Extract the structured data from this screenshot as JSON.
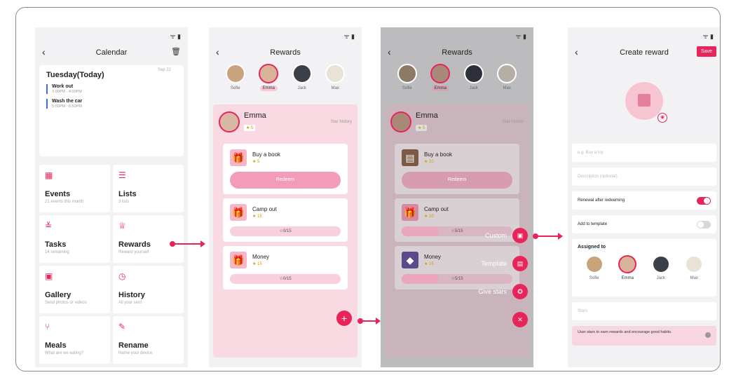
{
  "calendar": {
    "title": "Calendar",
    "day_title": "Tuesday(Today)",
    "day_date": "Sep 22",
    "events": [
      {
        "name": "Work out",
        "time": "3:00PM - 4:00PM"
      },
      {
        "name": "Wash the car",
        "time": "5:00PM - 6:50PM"
      }
    ],
    "tiles": [
      {
        "icon": "calendar-icon",
        "glyph": "▦",
        "name": "Events",
        "sub": "21 events this month"
      },
      {
        "icon": "list-icon",
        "glyph": "☰",
        "name": "Lists",
        "sub": "3 lists"
      },
      {
        "icon": "tasks-icon",
        "glyph": "≚",
        "name": "Tasks",
        "sub": "14 remaining"
      },
      {
        "icon": "rewards-icon",
        "glyph": "♕",
        "name": "Rewards",
        "sub": "Reward yourself"
      },
      {
        "icon": "gallery-icon",
        "glyph": "▣",
        "name": "Gallery",
        "sub": "Send photos or videos"
      },
      {
        "icon": "history-icon",
        "glyph": "◷",
        "name": "History",
        "sub": "All your sent"
      },
      {
        "icon": "meals-icon",
        "glyph": "⑂",
        "name": "Meals",
        "sub": "What are we eating?"
      },
      {
        "icon": "rename-icon",
        "glyph": "✎",
        "name": "Rename",
        "sub": "Name your device"
      }
    ]
  },
  "rewards": {
    "title": "Rewards",
    "people": [
      "Sofie",
      "Emma",
      "Jack",
      "Max"
    ],
    "selected_name": "Emma",
    "selected_stars": "★ 5",
    "star_history": "Star history",
    "cards": [
      {
        "title": "Buy a book",
        "stars": "★ 5",
        "action": "Redeem"
      },
      {
        "title": "Camp out",
        "stars": "★ 15",
        "progress_text": "☆0/15",
        "progress": 0.0
      },
      {
        "title": "Money",
        "stars": "★ 15",
        "progress_text": "☆0/15",
        "progress": 0.0
      }
    ],
    "fab": "+"
  },
  "rewards_menu": {
    "stars": "★ 5",
    "card_stars_1": "★ 10",
    "card_stars_2": "★ 10",
    "card_stars_3": "★ 15",
    "progress_1": "☆5/15",
    "progress_2": "☆5/15",
    "items": [
      {
        "label": "Custom",
        "icon": "custom-reward-icon"
      },
      {
        "label": "Template",
        "icon": "template-icon"
      },
      {
        "label": "Give stars",
        "icon": "give-stars-icon"
      }
    ],
    "close": "✕"
  },
  "create_reward": {
    "title": "Create reward",
    "save": "Save",
    "name_placeholder": "e.g. Buy a toy",
    "desc_placeholder": "Description (optional)",
    "renewal_label": "Renewal after redeeming",
    "renewal_on": true,
    "template_label": "Add to template",
    "template_on": false,
    "assigned_label": "Assigned to",
    "stars_placeholder": "Stars",
    "note": "User stars to earn rewards and encourage good habits."
  }
}
